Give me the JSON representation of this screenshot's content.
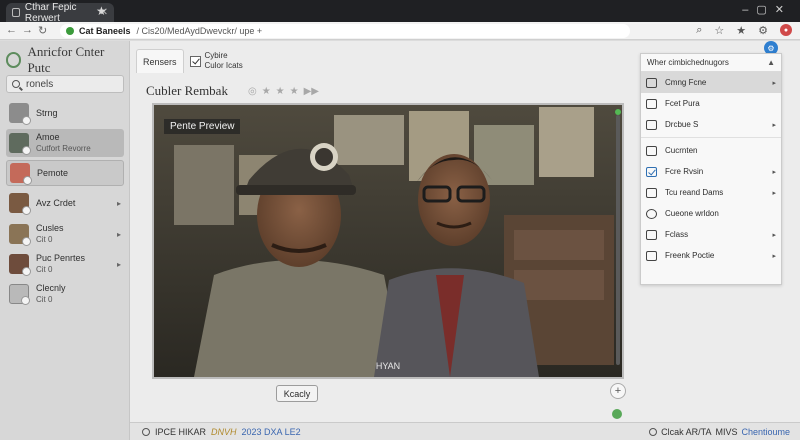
{
  "browser": {
    "tab_title": "Cthar Fepic Rerwert",
    "url_host": "Cat Baneels",
    "url_path": "/  Cis20/MedAydDwevckr/ upe +"
  },
  "sidebar": {
    "brand": "Anricfor Cnter Putc",
    "search_value": "ronels",
    "items": [
      {
        "title": "Strng",
        "sub": ""
      },
      {
        "title": "Amoe",
        "sub": "Cutfort Revorre"
      },
      {
        "title": "Pemote",
        "sub": ""
      },
      {
        "title": "Avz Crdet",
        "sub": ""
      },
      {
        "title": "Cusles",
        "sub": "Cit 0"
      },
      {
        "title": "Puc Penrtes",
        "sub": "Cit 0"
      },
      {
        "title": "Clecnly",
        "sub": "Cit 0"
      }
    ]
  },
  "tabs": {
    "t1": "Rensers",
    "t2a": "Cybire",
    "t2b": "Culor Icats"
  },
  "page": {
    "title": "Cubler Rembak"
  },
  "viewer": {
    "preview_label": "Pente Preview",
    "caption": "HYAN",
    "action": "Kcacly"
  },
  "menu": {
    "header": "Wher cimbichednugors",
    "items": [
      {
        "label": "Cmng Fcne"
      },
      {
        "label": "Fcet Pura"
      },
      {
        "label": "Drcbue S"
      },
      {
        "label": "Cucrnten"
      },
      {
        "label": "Fcre Rvsin"
      },
      {
        "label": "Tcu reand Dams"
      },
      {
        "label": "Cueone wrldon"
      },
      {
        "label": "Fclass"
      },
      {
        "label": "Freenk Poctie"
      }
    ]
  },
  "status": {
    "left_a": "IPCE HIKAR",
    "left_b": "DNVH",
    "left_c": "2023 DXA LE2",
    "right_a": "Clcak AR/TA",
    "right_b": "MIVS",
    "right_c": "Chentioume"
  },
  "colors": {
    "accent": "#2f7fd0",
    "ok": "#3c9b3c"
  }
}
